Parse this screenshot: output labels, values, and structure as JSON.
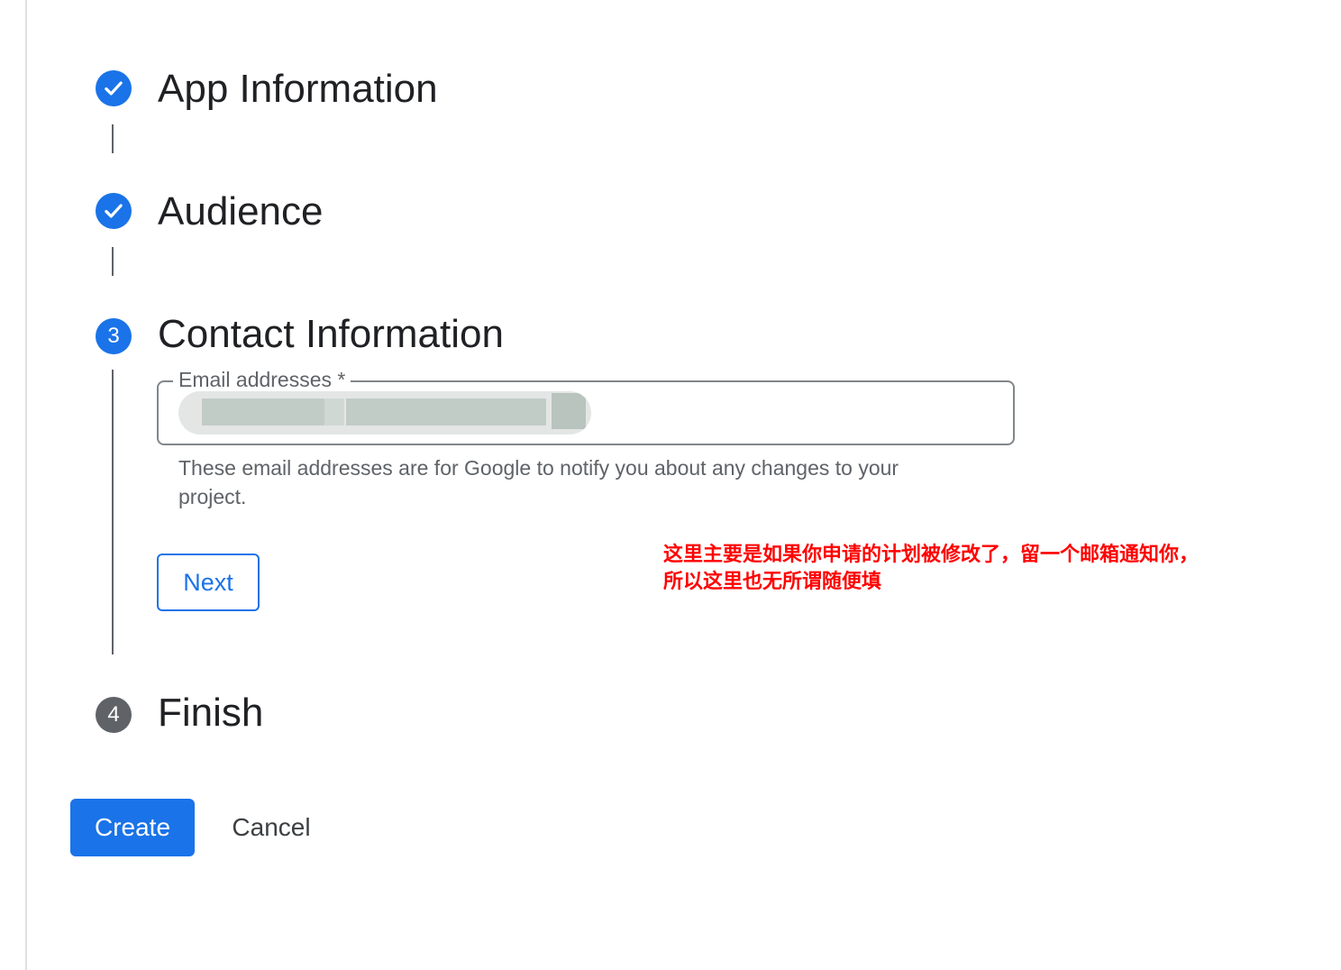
{
  "stepper": {
    "steps": [
      {
        "number": "1",
        "title": "App Information",
        "state": "completed",
        "icon": "check-icon"
      },
      {
        "number": "2",
        "title": "Audience",
        "state": "completed",
        "icon": "check-icon"
      },
      {
        "number": "3",
        "title": "Contact Information",
        "state": "active"
      },
      {
        "number": "4",
        "title": "Finish",
        "state": "pending"
      }
    ]
  },
  "contact": {
    "email_label": "Email addresses *",
    "email_value_state": "redacted",
    "helper_text": "These email addresses are for Google to notify you about any changes to your project.",
    "next_label": "Next"
  },
  "annotation": {
    "line1": "这里主要是如果你申请的计划被修改了，留一个邮箱通知你，",
    "line2": "所以这里也无所谓随便填"
  },
  "actions": {
    "create_label": "Create",
    "cancel_label": "Cancel"
  },
  "colors": {
    "primary": "#1a73e8",
    "pending": "#5f6368",
    "annotation": "#ff0000",
    "text": "#202124"
  }
}
